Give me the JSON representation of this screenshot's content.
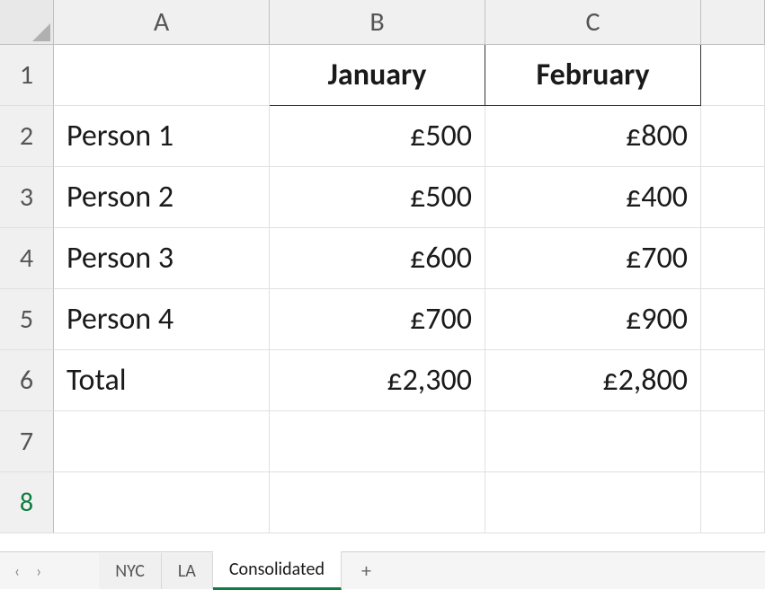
{
  "columns": [
    "A",
    "B",
    "C"
  ],
  "rows": [
    "1",
    "2",
    "3",
    "4",
    "5",
    "6",
    "7",
    "8"
  ],
  "headers": {
    "b1": "January",
    "c1": "February"
  },
  "data": {
    "a2": "Person 1",
    "b2": "£500",
    "c2": "£800",
    "a3": "Person 2",
    "b3": "£500",
    "c3": "£400",
    "a4": "Person 3",
    "b4": "£600",
    "c4": "£700",
    "a5": "Person 4",
    "b5": "£700",
    "c5": "£900",
    "a6": "Total",
    "b6": "£2,300",
    "c6": "£2,800"
  },
  "tabs": {
    "prev": "‹",
    "next": "›",
    "items": [
      {
        "label": "NYC",
        "active": false
      },
      {
        "label": "LA",
        "active": false
      },
      {
        "label": "Consolidated",
        "active": true
      }
    ],
    "add": "+"
  },
  "chart_data": {
    "type": "table",
    "title": "",
    "columns": [
      "",
      "January",
      "February"
    ],
    "rows": [
      [
        "Person 1",
        500,
        800
      ],
      [
        "Person 2",
        500,
        400
      ],
      [
        "Person 3",
        600,
        700
      ],
      [
        "Person 4",
        700,
        900
      ],
      [
        "Total",
        2300,
        2800
      ]
    ],
    "currency": "£"
  }
}
